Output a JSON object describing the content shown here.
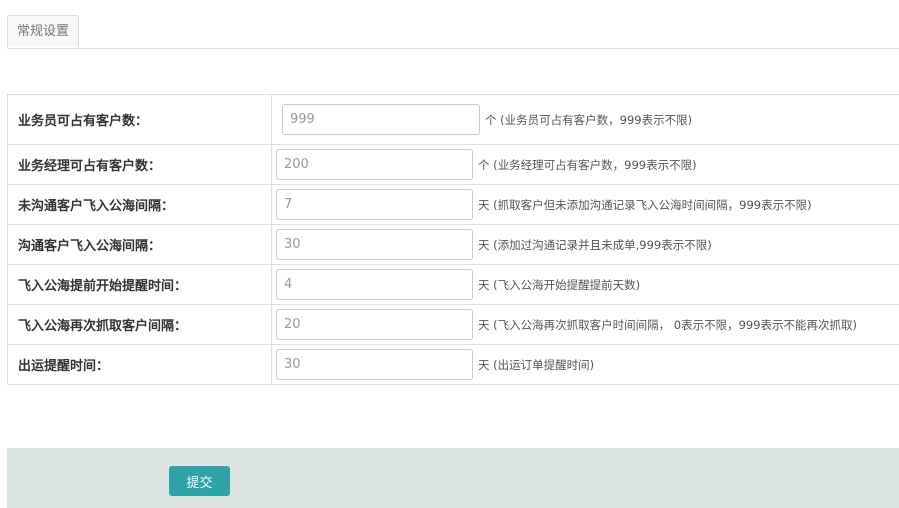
{
  "tabs": [
    {
      "label": "常规设置"
    }
  ],
  "rows": [
    {
      "label": "业务员可占有客户数：",
      "value": "999",
      "hint": "个 (业务员可占有客户数，999表示不限)"
    },
    {
      "label": "业务经理可占有客户数：",
      "value": "200",
      "hint": "个 (业务经理可占有客户数，999表示不限)"
    },
    {
      "label": "未沟通客户飞入公海间隔：",
      "value": "7",
      "hint": "天 (抓取客户但未添加沟通记录飞入公海时间间隔，999表示不限)"
    },
    {
      "label": "沟通客户飞入公海间隔：",
      "value": "30",
      "hint": "天 (添加过沟通记录并且未成单,999表示不限)"
    },
    {
      "label": "飞入公海提前开始提醒时间：",
      "value": "4",
      "hint": "天 (飞入公海开始提醒提前天数)"
    },
    {
      "label": "飞入公海再次抓取客户间隔：",
      "value": "20",
      "hint": "天 (飞入公海再次抓取客户时间间隔， 0表示不限，999表示不能再次抓取)"
    },
    {
      "label": "出运提醒时间：",
      "value": "30",
      "hint": "天 (出运订单提醒时间)"
    }
  ],
  "footer": {
    "submit_label": "提交"
  },
  "colors": {
    "accent": "#2fa4a8",
    "footer_bg": "#dde4e4",
    "border": "#dddddd"
  }
}
